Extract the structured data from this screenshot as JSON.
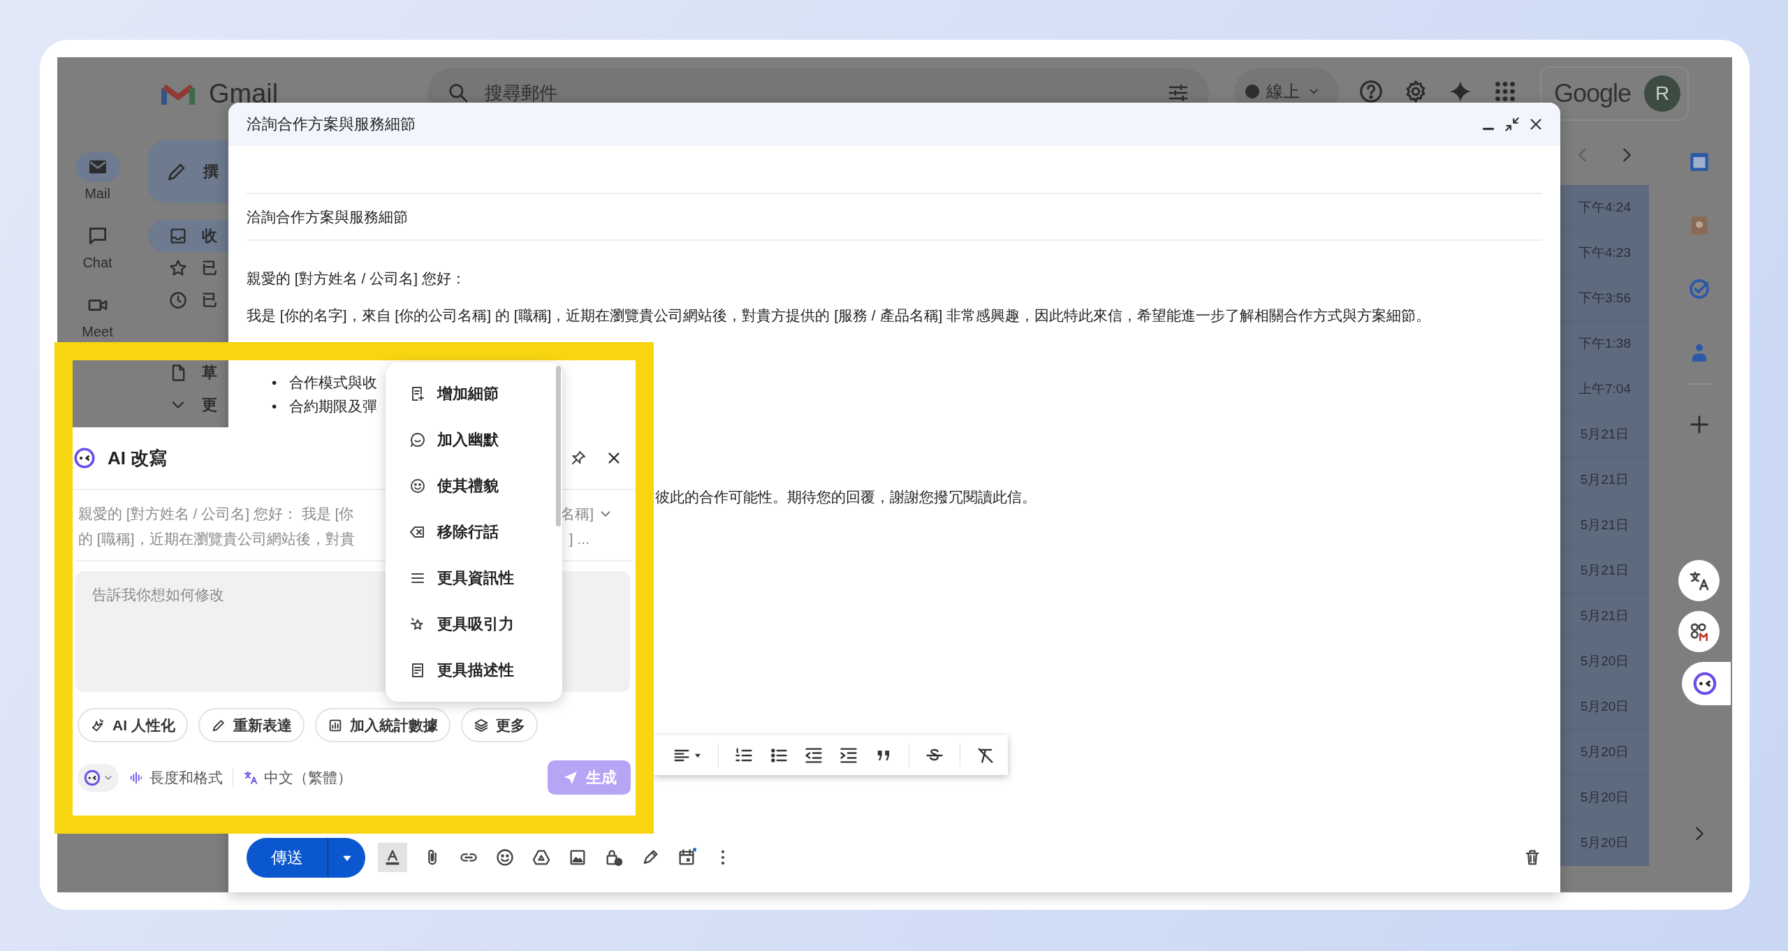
{
  "gmail": {
    "logo": "Gmail",
    "search": {
      "placeholder": "搜尋郵件"
    },
    "status": "線上",
    "brand": "Google",
    "avatar": "R",
    "rail": [
      {
        "label": "Mail",
        "selected": true
      },
      {
        "label": "Chat",
        "selected": false
      },
      {
        "label": "Meet",
        "selected": false
      }
    ],
    "compose_button": "撰",
    "nav": [
      {
        "label": "收",
        "selected": true
      },
      {
        "label": "已",
        "selected": false
      },
      {
        "label": "已",
        "selected": false
      },
      {
        "label": "草",
        "selected": false
      },
      {
        "label": "更",
        "selected": false
      }
    ],
    "times": [
      "下午4:24",
      "下午4:23",
      "下午3:56",
      "下午1:38",
      "上午7:04",
      "5月21日",
      "5月21日",
      "5月21日",
      "5月21日",
      "5月21日",
      "5月20日",
      "5月20日",
      "5月20日",
      "5月20日",
      "5月20日"
    ]
  },
  "compose": {
    "title": "洽詢合作方案與服務細節",
    "subject": "洽詢合作方案與服務細節",
    "greeting": "親愛的 [對方姓名 / 公司名] 您好：",
    "paragraph": "我是 [你的名字]，來自 [你的公司名稱] 的 [職稱]，近期在瀏覽貴公司網站後，對貴方提供的 [服務 / 產品名稱] 非常感興趣，因此特此來信，希望能進一步了解相關合作方式與方案細節。",
    "bullets": [
      {
        "marker": "•",
        "text": "合作模式與收"
      },
      {
        "marker": "•",
        "text": "合約期限及彈"
      }
    ],
    "closing": "彼此的合作可能性。期待您的回覆，謝謝您撥冗閱讀此信。",
    "send": "傳送"
  },
  "ai_panel": {
    "title": "AI 改寫",
    "preview": [
      {
        "left": "親愛的 [對方姓名 / 公司名] 您好： 我是 [你",
        "right": "名稱]"
      },
      {
        "left": "的 [職稱]，近期在瀏覽貴公司網站後，對貴",
        "right": "] ..."
      }
    ],
    "instruction": {
      "placeholder": "告訴我你想如何修改"
    },
    "chips": [
      "AI 人性化",
      "重新表達",
      "加入統計數據",
      "更多"
    ],
    "length_format": "長度和格式",
    "language": "中文（繁體）",
    "generate": {
      "label": "生成",
      "disabled": true
    }
  },
  "rewrite_menu": [
    "增加細節",
    "加入幽默",
    "使其禮貌",
    "移除行話",
    "更具資訊性",
    "更具吸引力",
    "更具描述性"
  ]
}
